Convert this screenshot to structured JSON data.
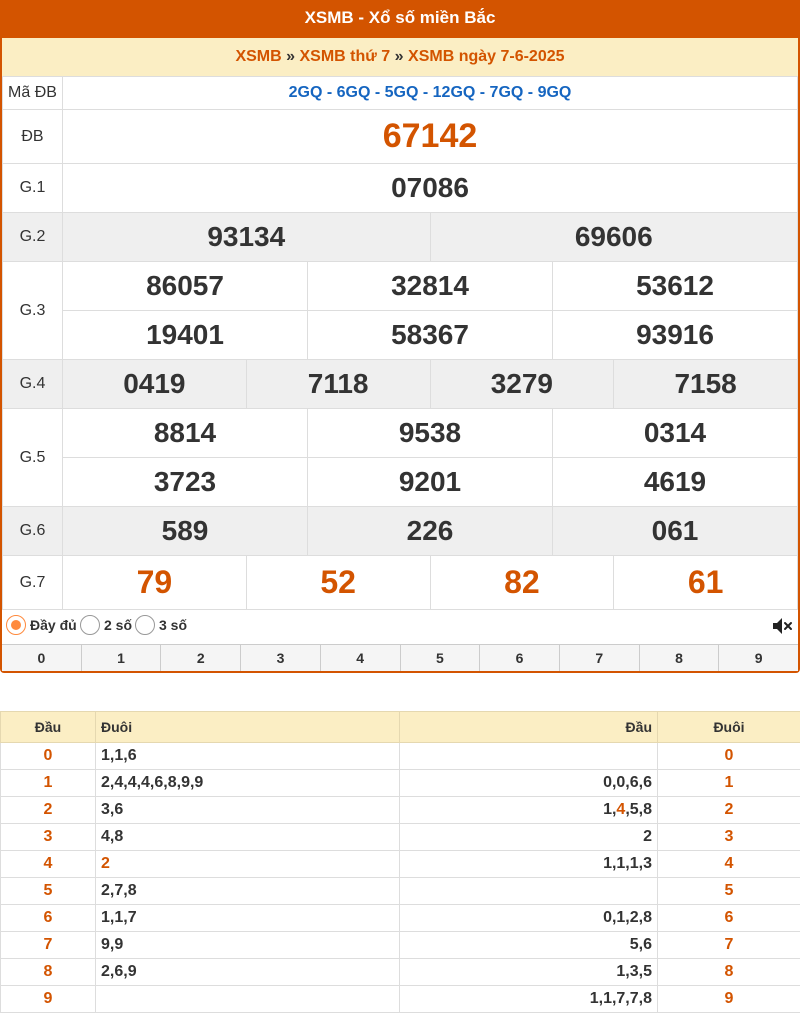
{
  "header": {
    "title": "XSMB - Xổ số miền Bắc"
  },
  "breadcrumb": {
    "sep": "»",
    "items": [
      "XSMB",
      "XSMB thứ 7",
      "XSMB ngày 7-6-2025"
    ]
  },
  "results": {
    "ma_db_label": "Mã ĐB",
    "ma_db_value": "2GQ - 6GQ - 5GQ - 12GQ - 7GQ - 9GQ",
    "db_label": "ĐB",
    "db": "67142",
    "g1_label": "G.1",
    "g1": "07086",
    "g2_label": "G.2",
    "g2": [
      "93134",
      "69606"
    ],
    "g3_label": "G.3",
    "g3": [
      "86057",
      "32814",
      "53612",
      "19401",
      "58367",
      "93916"
    ],
    "g4_label": "G.4",
    "g4": [
      "0419",
      "7118",
      "3279",
      "7158"
    ],
    "g5_label": "G.5",
    "g5": [
      "8814",
      "9538",
      "0314",
      "3723",
      "9201",
      "4619"
    ],
    "g6_label": "G.6",
    "g6": [
      "589",
      "226",
      "061"
    ],
    "g7_label": "G.7",
    "g7": [
      "79",
      "52",
      "82",
      "61"
    ]
  },
  "options": {
    "full": "Đầy đủ",
    "two": "2 số",
    "three": "3 số",
    "selected": "full"
  },
  "digits": [
    "0",
    "1",
    "2",
    "3",
    "4",
    "5",
    "6",
    "7",
    "8",
    "9"
  ],
  "loto": {
    "headers": [
      "Đầu",
      "Đuôi",
      "Đầu",
      "Đuôi"
    ],
    "rows": [
      {
        "d": "0",
        "left": "1,1,6",
        "right": "",
        "t": "0"
      },
      {
        "d": "1",
        "left": "2,4,4,4,6,8,9,9",
        "right": "0,0,6,6",
        "t": "1"
      },
      {
        "d": "2",
        "left": "3,6",
        "right": "1,4,5,8",
        "t": "2"
      },
      {
        "d": "3",
        "left": "4,8",
        "right": "2",
        "t": "3"
      },
      {
        "d": "4",
        "left": "2",
        "right": "1,1,1,3",
        "t": "4"
      },
      {
        "d": "5",
        "left": "2,7,8",
        "right": "",
        "t": "5"
      },
      {
        "d": "6",
        "left": "1,1,7",
        "right": "0,1,2,8",
        "t": "6"
      },
      {
        "d": "7",
        "left": "9,9",
        "right": "5,6",
        "t": "7"
      },
      {
        "d": "8",
        "left": "2,6,9",
        "right": "1,3,5",
        "t": "8"
      },
      {
        "d": "9",
        "left": "",
        "right": "1,1,7,7,8",
        "t": "9"
      }
    ]
  },
  "colors": {
    "accent": "#d35400",
    "header_bg": "#fbeec4",
    "link_blue": "#1565c0"
  }
}
